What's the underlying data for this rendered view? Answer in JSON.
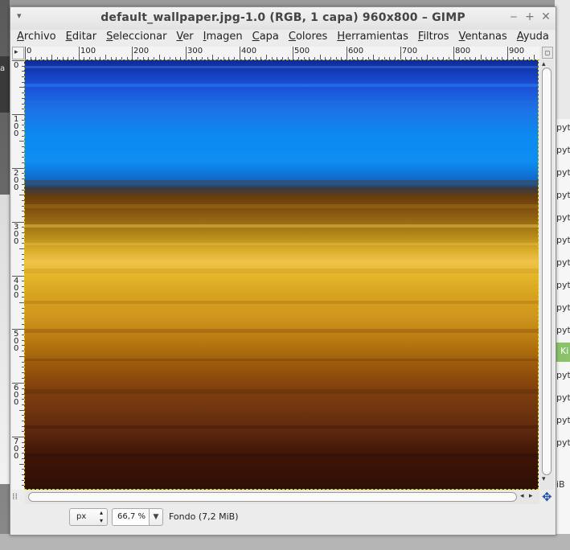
{
  "window": {
    "title": "default_wallpaper.jpg-1.0 (RGB, 1 capa) 960x800 – GIMP"
  },
  "menubar": {
    "items": [
      {
        "label": "Archivo",
        "mnemonic": "A",
        "rest": "rchivo"
      },
      {
        "label": "Editar",
        "mnemonic": "E",
        "rest": "ditar"
      },
      {
        "label": "Seleccionar",
        "mnemonic": "S",
        "rest": "eleccionar"
      },
      {
        "label": "Ver",
        "mnemonic": "V",
        "rest": "er"
      },
      {
        "label": "Imagen",
        "mnemonic": "I",
        "rest": "magen"
      },
      {
        "label": "Capa",
        "mnemonic": "C",
        "rest": "apa"
      },
      {
        "label": "Colores",
        "mnemonic": "C",
        "rest": "olores"
      },
      {
        "label": "Herramientas",
        "mnemonic": "H",
        "rest": "erramientas"
      },
      {
        "label": "Filtros",
        "mnemonic": "F",
        "rest": "iltros"
      },
      {
        "label": "Ventanas",
        "mnemonic": "V",
        "rest": "entanas"
      },
      {
        "label": "Ayuda",
        "mnemonic": "A",
        "rest": "yuda"
      }
    ]
  },
  "ruler": {
    "top_labels": [
      "0",
      "100",
      "200",
      "300",
      "400",
      "500",
      "600",
      "700",
      "800",
      "900"
    ],
    "left_labels": [
      "0",
      "100",
      "200",
      "300",
      "400",
      "500",
      "600",
      "700"
    ]
  },
  "statusbar": {
    "unit": "px",
    "zoom": "66,7 %",
    "message": "Fondo (7,2 MiB)"
  },
  "background": {
    "left_label": "a",
    "right_items": [
      "pyte",
      "pyte",
      "pyte",
      "pyte",
      "pyte",
      "pyte",
      "pyte",
      "pyte",
      "pyte",
      "pyte",
      "pyte",
      "pyte",
      "pyte",
      "pyte",
      "pyte",
      "iB"
    ],
    "right_green_text": "Ki"
  }
}
